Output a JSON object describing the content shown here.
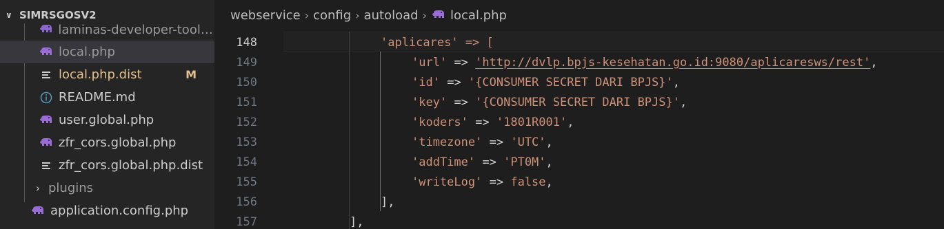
{
  "sidebar": {
    "title": "SIMRSGOSV2",
    "items": [
      {
        "label": "laminas-developer-tools...",
        "icon": "php-elephant-icon",
        "state": "dim"
      },
      {
        "label": "local.php",
        "icon": "php-elephant-icon",
        "state": "selected"
      },
      {
        "label": "local.php.dist",
        "icon": "lines-file-icon",
        "state": "modified",
        "badge": "M"
      },
      {
        "label": "README.md",
        "icon": "info-icon",
        "state": "normal"
      },
      {
        "label": "user.global.php",
        "icon": "php-elephant-icon",
        "state": "normal"
      },
      {
        "label": "zfr_cors.global.php",
        "icon": "php-elephant-icon",
        "state": "normal"
      },
      {
        "label": "zfr_cors.global.php.dist",
        "icon": "lines-file-icon",
        "state": "normal"
      }
    ],
    "folder_plugins": "plugins",
    "application_config": "application.config.php"
  },
  "breadcrumb": {
    "parts": [
      "webservice",
      "config",
      "autoload"
    ],
    "file": "local.php"
  },
  "code": {
    "lines": [
      {
        "n": "148",
        "text": "'aplicares' => ["
      },
      {
        "n": "149",
        "key": "'url'",
        "value": "'http://dvlp.bpjs-kesehatan.go.id:9080/aplicaresws/rest'"
      },
      {
        "n": "150",
        "key": "'id'",
        "value": "'{CONSUMER SECRET DARI BPJS}'"
      },
      {
        "n": "151",
        "key": "'key'",
        "value": "'{CONSUMER SECRET DARI BPJS}'"
      },
      {
        "n": "152",
        "key": "'koders'",
        "value": "'1801R001'"
      },
      {
        "n": "153",
        "key": "'timezone'",
        "value": "'UTC'"
      },
      {
        "n": "154",
        "key": "'addTime'",
        "value": "'PT0M'"
      },
      {
        "n": "155",
        "key": "'writeLog'",
        "value": "false"
      },
      {
        "n": "156",
        "text": "],"
      },
      {
        "n": "157",
        "text": "],"
      }
    ],
    "arrow": "=>",
    "comma": ","
  },
  "colors": {
    "string": "#ce9178",
    "keyword": "#569cd6",
    "modified": "#e2c08d",
    "php_icon": "#9b6bd8"
  }
}
